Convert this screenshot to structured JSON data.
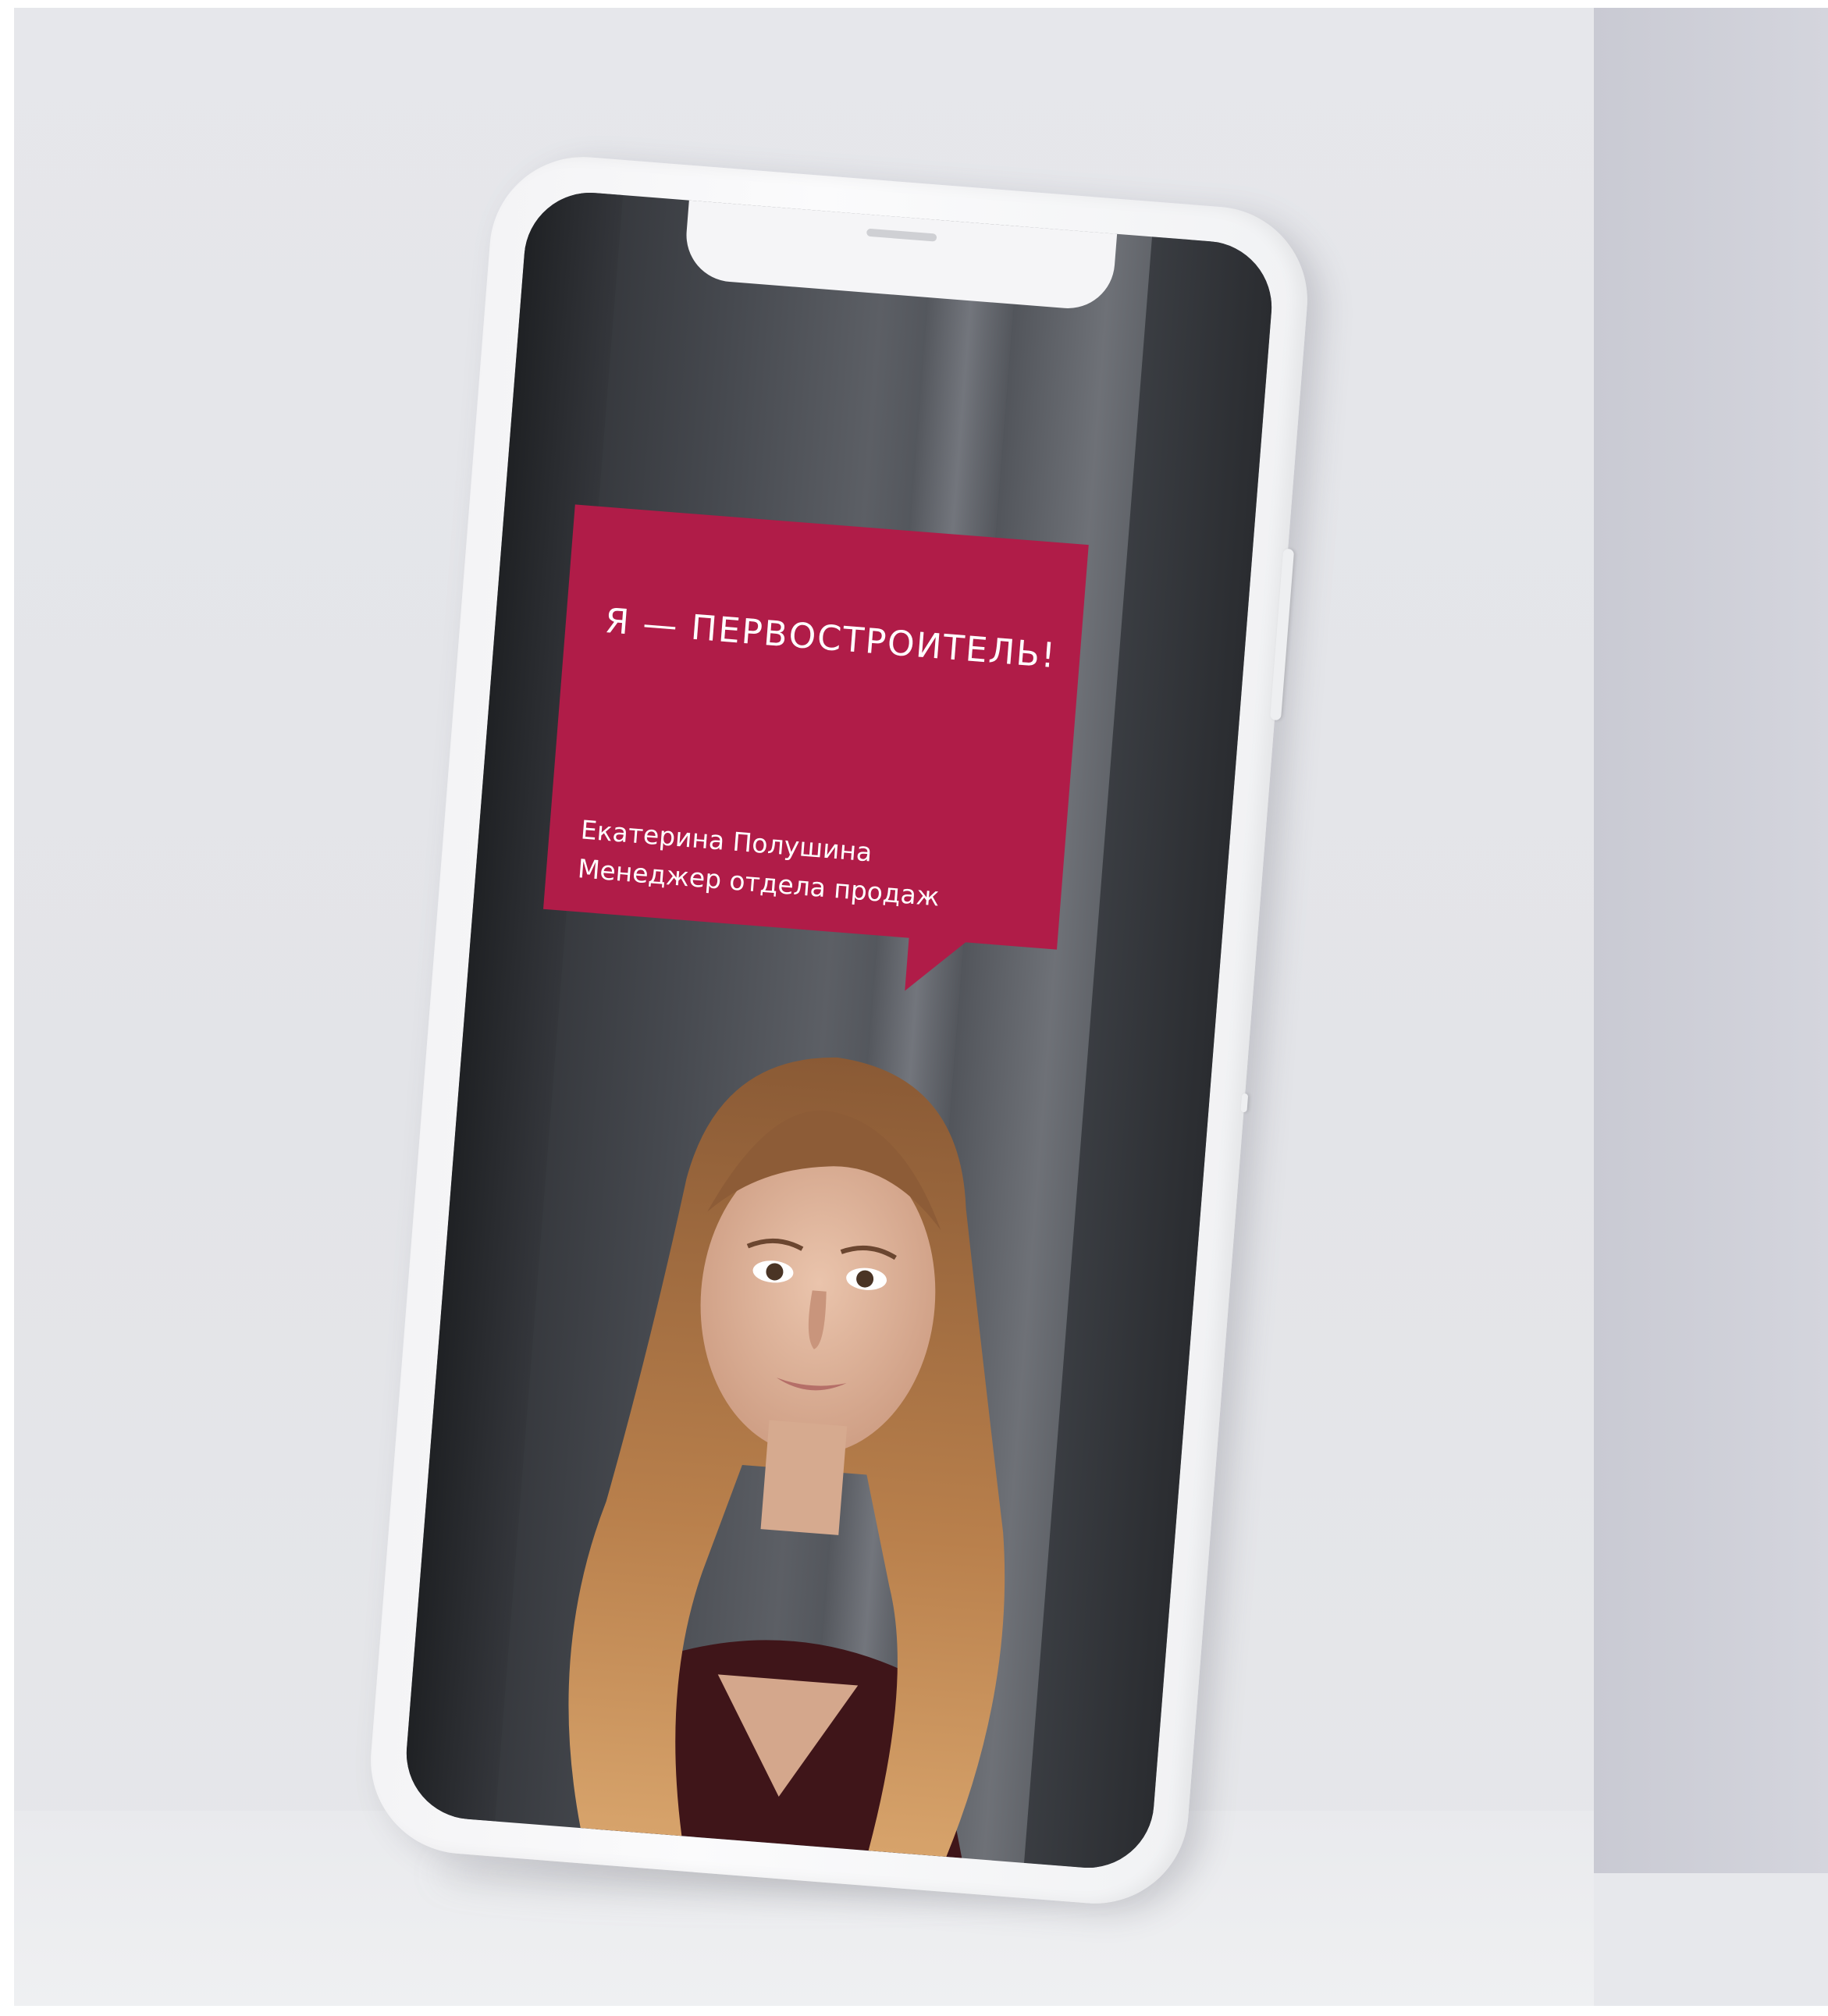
{
  "card": {
    "headline": "Я — ПЕРВОСТРОИТЕЛЬ!",
    "name": "Екатерина Полушина",
    "role": "Менеджер отдела продаж"
  },
  "colors": {
    "wall": "#e5e6ea",
    "side_wall": "#ccccd5",
    "phone_body": "#f6f6f8",
    "bubble": "#b01c48",
    "screen_bg": "#45484e",
    "hair": "#b37a48",
    "skin": "#e2b9a0",
    "dress": "#4a1a20"
  },
  "icons": {
    "speaker": "speaker-grille-icon"
  }
}
